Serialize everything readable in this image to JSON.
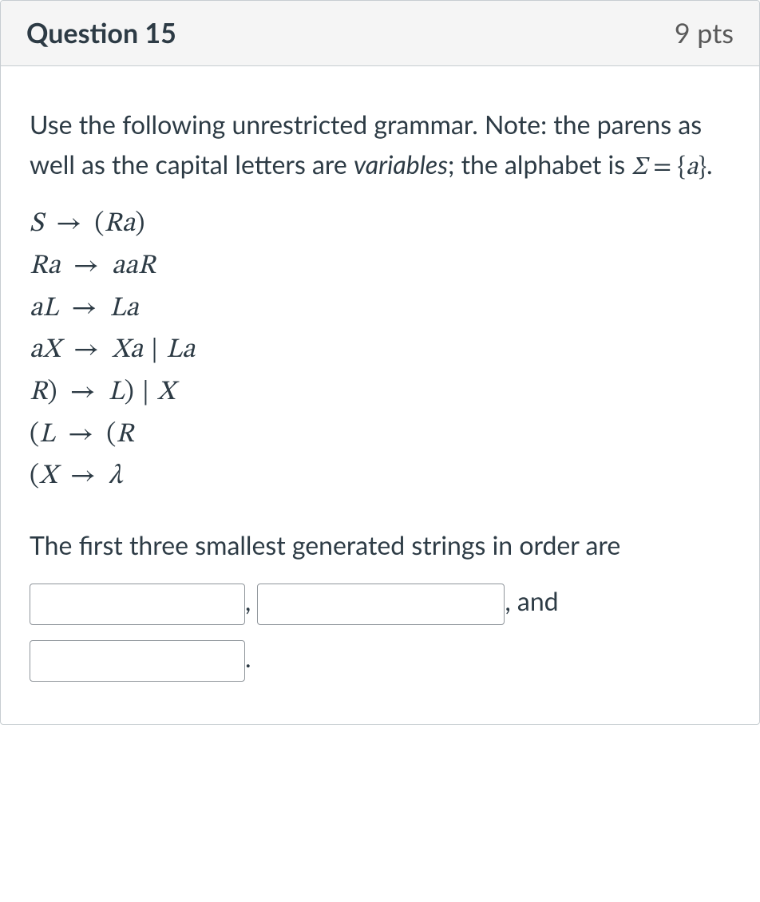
{
  "header": {
    "title": "Question 15",
    "points": "9 pts"
  },
  "intro": {
    "line1": "Use the following unrestricted grammar. Note: the parens as well as the capital letters are ",
    "variables_word": "variables",
    "line2": "; the alphabet is ",
    "sigma_expr": "Σ = {a}",
    "period": "."
  },
  "grammar": {
    "rows": [
      {
        "lhs": "S",
        "rhs": "(Ra)"
      },
      {
        "lhs": "Ra",
        "rhs": "aaR"
      },
      {
        "lhs": "aL",
        "rhs": "La"
      },
      {
        "lhs": "aX",
        "rhs": "Xa | La"
      },
      {
        "lhs": "R)",
        "rhs": "L) | X"
      },
      {
        "lhs": "(L",
        "rhs": "(R"
      },
      {
        "lhs": "(X",
        "rhs": "λ"
      }
    ],
    "arrow": "→",
    "pipe": "|"
  },
  "answer": {
    "lead": "The first three smallest generated strings in order are ",
    "comma1": ", ",
    "comma_and": ", and ",
    "trailing_period": ".",
    "blank1": "",
    "blank2": "",
    "blank3": ""
  }
}
